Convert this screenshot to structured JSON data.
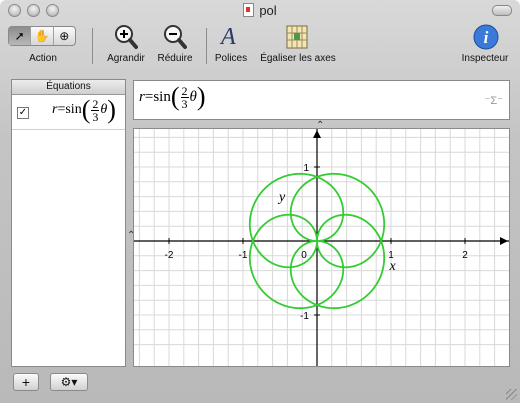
{
  "window": {
    "title": "pol"
  },
  "toolbar": {
    "action_label": "Action",
    "agrandir_label": "Agrandir",
    "reduire_label": "Réduire",
    "polices_label": "Polices",
    "egaliser_label": "Égaliser les axes",
    "inspecteur_label": "Inspecteur"
  },
  "sidebar": {
    "header": "Équations",
    "equations": [
      {
        "checked": true,
        "lhs": "r",
        "fn": "sin",
        "num": "2",
        "den": "3",
        "var": "θ"
      }
    ]
  },
  "equation_bar": {
    "lhs": "r",
    "fn": "sin",
    "num": "2",
    "den": "3",
    "var": "θ",
    "sigma": "⁻Σ⁻"
  },
  "bottom": {
    "add_label": "+",
    "gear_label": "⚙▾"
  },
  "chart_data": {
    "type": "line",
    "title": "",
    "xlabel": "x",
    "ylabel": "y",
    "xlim": [
      -2.5,
      2.5
    ],
    "ylim": [
      -1.4,
      1.4
    ],
    "xticks": [
      -2,
      -1,
      0,
      1,
      2
    ],
    "yticks": [
      -1,
      1
    ],
    "x_tick_labels": [
      "-2",
      "-1",
      "0",
      "1",
      "2"
    ],
    "y_tick_labels": [
      "-1",
      "1"
    ],
    "grid": true,
    "curve": {
      "equation": "r = sin(2/3 θ)",
      "coordinates": "polar",
      "theta_range": [
        0,
        18.8496
      ],
      "color": "#33cc33"
    }
  }
}
